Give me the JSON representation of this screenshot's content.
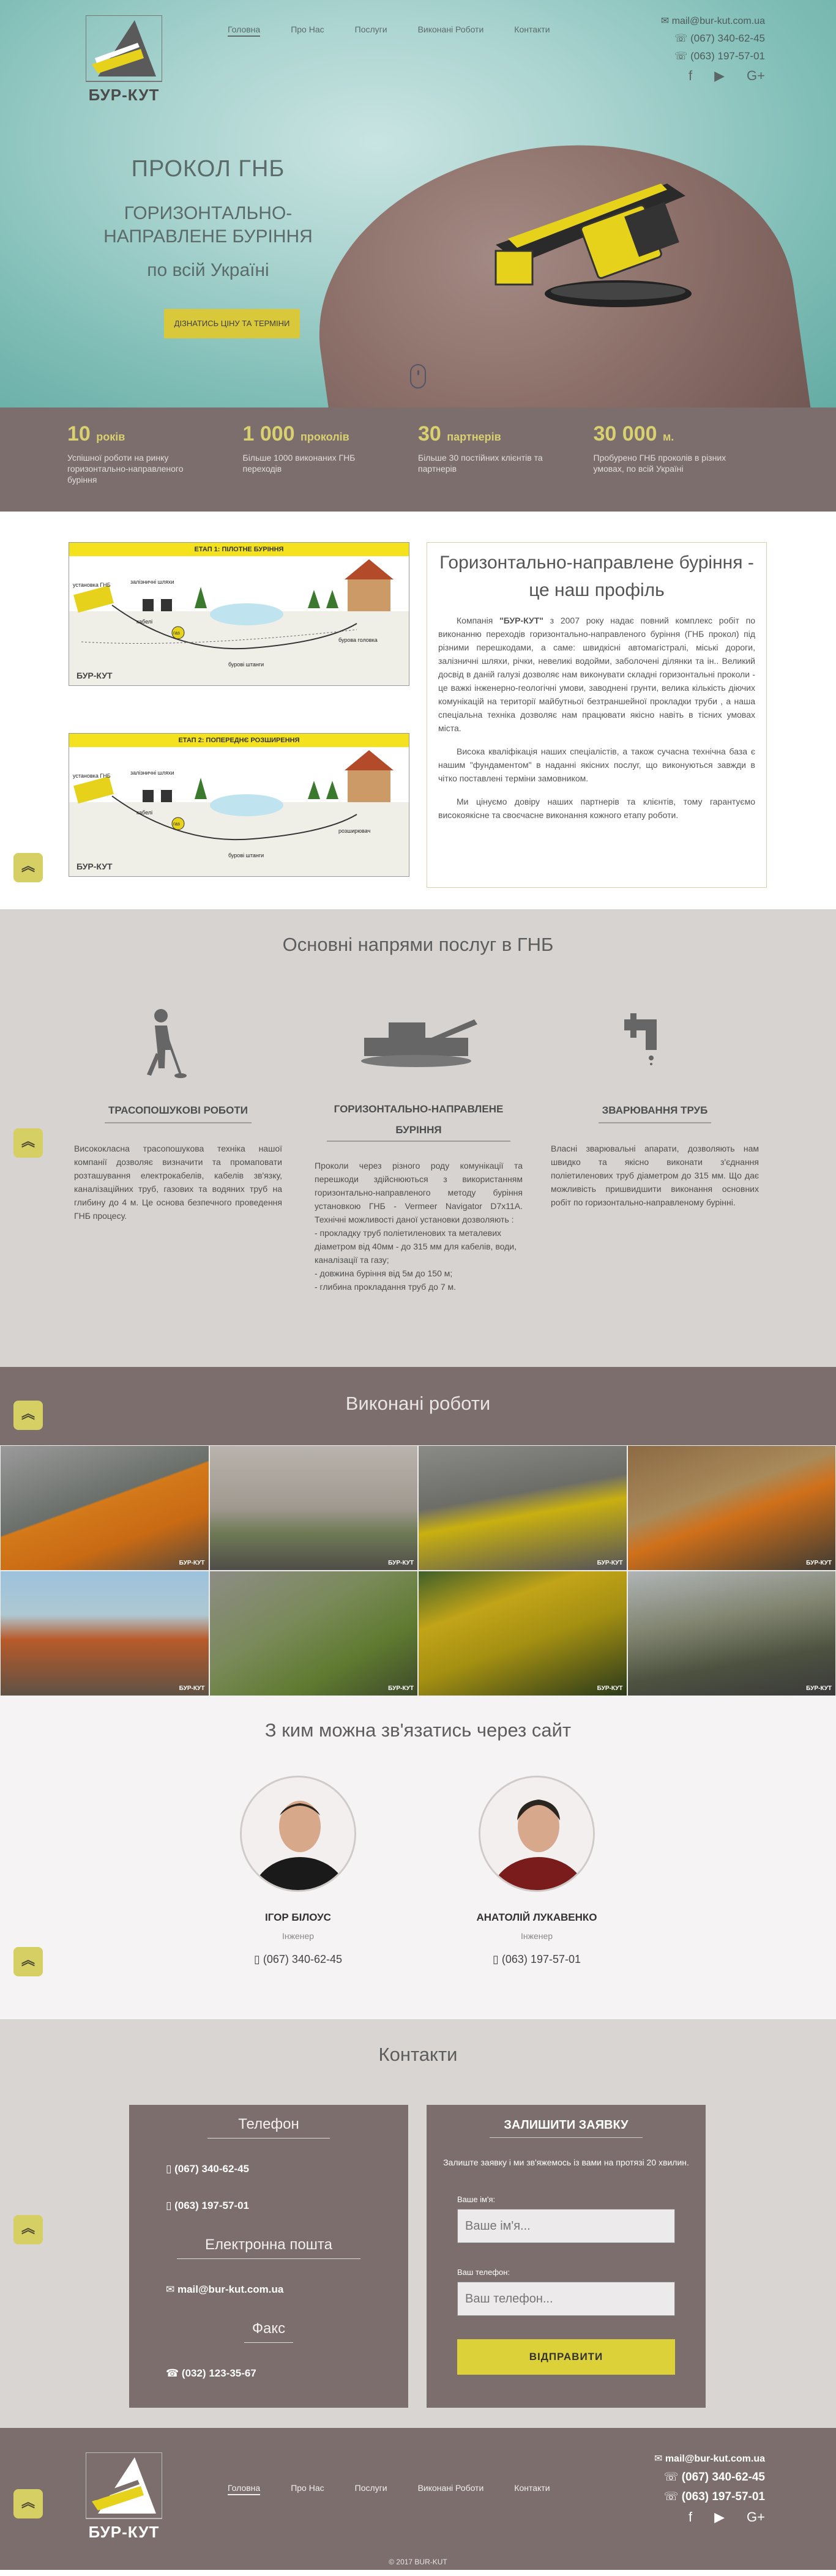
{
  "brand": {
    "name": "БУР-КУТ"
  },
  "nav": [
    "Головна",
    "Про Нас",
    "Послуги",
    "Виконані Роботи",
    "Контакти"
  ],
  "header": {
    "email": "mail@bur-kut.com.ua",
    "phone1": "(067) 340-62-45",
    "phone2": "(063) 197-57-01"
  },
  "hero": {
    "title1": "ПРОКОЛ ГНБ",
    "title2": "ГОРИЗОНТАЛЬНО-НАПРАВЛЕНЕ БУРІННЯ",
    "title3": "по всій Україні",
    "cta": "ДІЗНАТИСЬ ЦІНУ ТА ТЕРМІНИ"
  },
  "stats": [
    {
      "num": "10",
      "unit": "років",
      "desc": "Успішної роботи на ринку горизонтально-направленого буріння"
    },
    {
      "num": "1 000",
      "unit": "проколів",
      "desc": "Більше 1000 виконаних ГНБ переходів"
    },
    {
      "num": "30",
      "unit": "партнерів",
      "desc": "Більше 30 постійних клієнтів та партнерів"
    },
    {
      "num": "30 000",
      "unit": "м.",
      "desc": "Пробурено ГНБ проколів в різних умовах, по всій Україні"
    }
  ],
  "stages": [
    {
      "banner": "ЕТАП 1: ПІЛОТНЕ БУРІННЯ",
      "l1": "установка ГНБ",
      "l2": "залізничні шляхи",
      "l3": "кабелі",
      "l4": "газ",
      "l5": "бурові штанги",
      "l6": "бурова головка"
    },
    {
      "banner": "ЕТАП 2: ПОПЕРЕДНЄ РОЗШИРЕННЯ",
      "l1": "установка ГНБ",
      "l2": "залізничні шляхи",
      "l3": "кабелі",
      "l4": "газ",
      "l5": "бурові штанги",
      "l6": "розширювач"
    }
  ],
  "about": {
    "title": "Горизонтально-направлене буріння - це наш профіль",
    "p1_pre": "Компанія ",
    "p1_brand": "\"БУР-КУТ\"",
    "p1_post": " з 2007 року надає повний комплекс робіт по виконанню переходів горизонтально-направленого буріння (ГНБ прокол) під різними перешкодами, а саме: швидкісні автомагістралі, міські дороги, залізничні шляхи, річки, невеликі водойми, заболочені ділянки та ін.. Великий досвід в даній галузі дозволяє нам виконувати складні горизонтальні проколи - це важкі інженерно-геологічні умови, заводнені грунти, велика кількість діючих комунікацій на території майбутньої безтраншейної прокладки труби , а наша спеціальна техніка дозволяє нам працювати якісно навіть в тісних умовах міста.",
    "p2": "Висока кваліфікація наших спеціалістів, а також сучасна технічна база є нашим \"фундаментом\" в наданні якісних послуг, що виконуються завжди в чітко поставлені терміни замовником.",
    "p3": "Ми цінуємо довіру наших партнерів та клієнтів, тому гарантуємо високоякісне та своєчасне виконання кожного етапу роботи."
  },
  "services": {
    "title": "Основні напрями послуг в ГНБ",
    "items": [
      {
        "title": "ТРАСОПОШУКОВІ РОБОТИ",
        "text": "Висококласна трасопошукова техніка нашої компанії дозволяє визначити та промаповати розташування електрокабелів, кабелів зв'язку, каналізаційних труб, газових та водяних труб на глибину до 4 м. Це основа безпечного проведення ГНБ процесу."
      },
      {
        "title": "ГОРИЗОНТАЛЬНО-НАПРАВЛЕНЕ БУРІННЯ",
        "text": "Проколи через різного роду комунікації та перешкоди здійснюються з використанням горизонтально-направленого методу буріння установкою ГНБ - Vermeer Navigator D7x11A. Технічні можливості даної установки дозволяють :",
        "bullets": [
          "- прокладку труб поліетиленових та металевих діаметром від 40мм - до 315 мм для кабелів, води, каналізації та газу;",
          "- довжина буріння від 5м до 150 м;",
          "- глибина прокладання труб до 7 м."
        ]
      },
      {
        "title": "ЗВАРЮВАННЯ ТРУБ",
        "text": "Власні зварювальні апарати, дозволяють нам швидко та якісно виконати з'єднання поліетиленових труб діаметром до 315 мм. Що дає можливість пришвидшити виконання основних робіт по горизонтально-направленому бурінні."
      }
    ]
  },
  "works": {
    "title": "Виконані роботи",
    "watermark": "БУР-КУТ"
  },
  "team": {
    "title": "З ким можна зв'язатись через сайт",
    "people": [
      {
        "name": "ІГОР БІЛОУС",
        "role": "Інженер",
        "phone": "(067) 340-62-45"
      },
      {
        "name": "АНАТОЛІЙ ЛУКАВЕНКО",
        "role": "Інженер",
        "phone": "(063) 197-57-01"
      }
    ]
  },
  "contacts": {
    "title": "Контакти",
    "phone_h": "Телефон",
    "phone1": "(067) 340-62-45",
    "phone2": "(063) 197-57-01",
    "email_h": "Електронна пошта",
    "email": "mail@bur-kut.com.ua",
    "fax_h": "Факс",
    "fax": "(032) 123-35-67"
  },
  "form": {
    "title": "ЗАЛИШИТИ ЗАЯВКУ",
    "sub": "Залиште заявку і ми зв'яжемось із вами на протязі 20 хвилин.",
    "name_label": "Ваше ім'я:",
    "name_ph": "Ваше ім'я...",
    "phone_label": "Ваш телефон:",
    "phone_ph": "Ваш телефон...",
    "submit": "ВІДПРАВИТИ"
  },
  "footer": {
    "copy": "© 2017 BUR-KUT"
  },
  "colors": {
    "accent": "#d9d070",
    "brown": "#7b6e6c",
    "button": "#dcd138"
  }
}
